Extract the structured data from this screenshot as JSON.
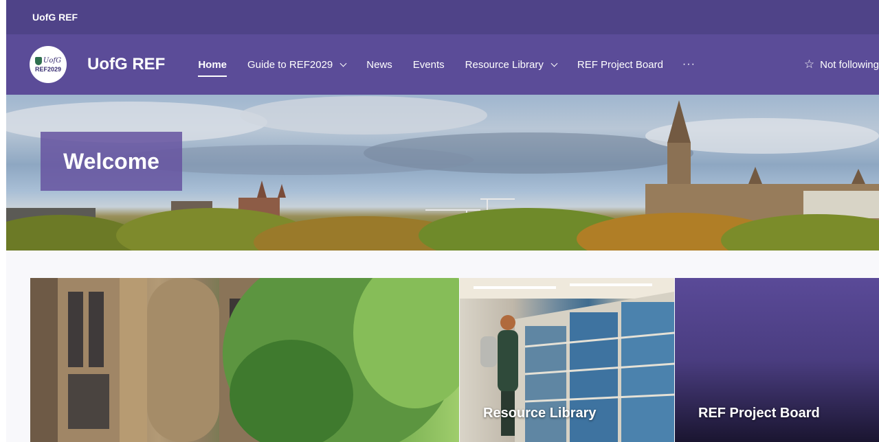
{
  "suitebar": {
    "title": "UofG REF"
  },
  "site": {
    "logo": {
      "line1": "UofG",
      "line2": "REF2029"
    },
    "title": "UofG REF"
  },
  "nav": {
    "items": [
      {
        "label": "Home",
        "active": true,
        "dropdown": false
      },
      {
        "label": "Guide to REF2029",
        "active": false,
        "dropdown": true
      },
      {
        "label": "News",
        "active": false,
        "dropdown": false
      },
      {
        "label": "Events",
        "active": false,
        "dropdown": false
      },
      {
        "label": "Resource Library",
        "active": false,
        "dropdown": true
      },
      {
        "label": "REF Project Board",
        "active": false,
        "dropdown": false
      }
    ],
    "more": "···",
    "follow_label": "Not following"
  },
  "hero": {
    "welcome": "Welcome"
  },
  "tiles": [
    {
      "label": ""
    },
    {
      "label": "Resource Library"
    },
    {
      "label": "REF Project Board"
    }
  ],
  "colors": {
    "suitebar": "#4f4388",
    "header": "#5b4c98",
    "welcome_box": "#6653a0"
  }
}
